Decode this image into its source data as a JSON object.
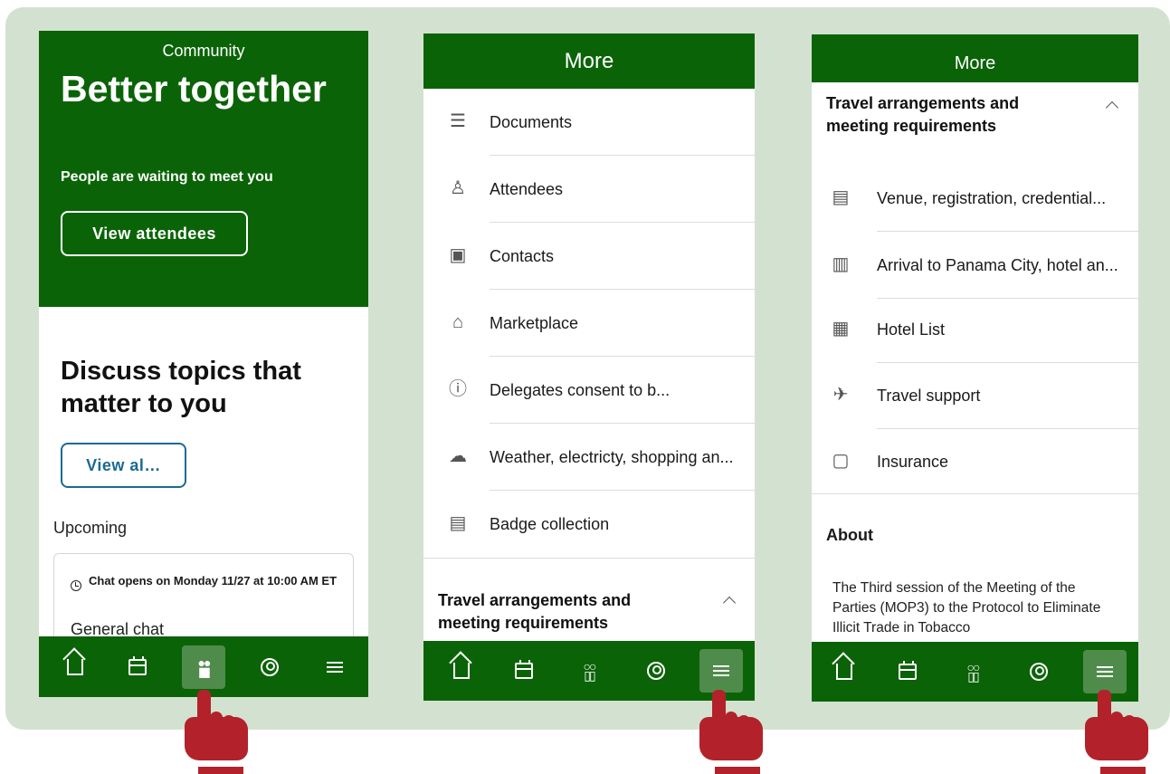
{
  "colors": {
    "brand_green": "#0b6307",
    "active_tab": "#4f8c4b",
    "frame_bg": "#d3e2d0",
    "link_blue": "#1b6a92",
    "pointer_red": "#b3222a"
  },
  "screen1": {
    "header_small": "Community",
    "hero_title": "Better together",
    "hero_desc": "People are waiting to meet you",
    "view_attendees": "View attendees",
    "section_title": "Discuss topics that matter to you",
    "view_all": "View al…",
    "upcoming_label": "Upcoming",
    "card_time": "Chat opens on Monday 11/27 at 10:00 AM ET",
    "card_title": "General chat",
    "active_tab": "community"
  },
  "screen2": {
    "header": "More",
    "items": [
      {
        "label": "Documents",
        "icon": "document-icon"
      },
      {
        "label": "Attendees",
        "icon": "people-icon"
      },
      {
        "label": "Contacts",
        "icon": "contacts-icon"
      },
      {
        "label": "Marketplace",
        "icon": "marketplace-icon"
      },
      {
        "label": "Delegates consent to b...",
        "icon": "info-icon"
      },
      {
        "label": "Weather, electricty, shopping an...",
        "icon": "weather-icon"
      },
      {
        "label": "Badge collection",
        "icon": "badge-icon"
      }
    ],
    "section": "Travel arrangements and meeting requirements",
    "active_tab": "menu"
  },
  "screen3": {
    "header": "More",
    "section": "Travel arrangements and meeting requirements",
    "items": [
      {
        "label": "Venue, registration, credential...",
        "icon": "badge-icon"
      },
      {
        "label": "Arrival to Panama City, hotel an...",
        "icon": "building-icon"
      },
      {
        "label": "Hotel List",
        "icon": "hotel-icon"
      },
      {
        "label": "Travel support",
        "icon": "plane-icon"
      },
      {
        "label": "Insurance",
        "icon": "insurance-icon"
      }
    ],
    "about_title": "About",
    "about_text": "The Third session of the Meeting of the Parties (MOP3) to the Protocol to Eliminate Illicit Trade in Tobacco",
    "active_tab": "menu"
  },
  "nav_icons": [
    "home-icon",
    "calendar-icon",
    "community-icon",
    "profile-icon",
    "menu-icon"
  ]
}
